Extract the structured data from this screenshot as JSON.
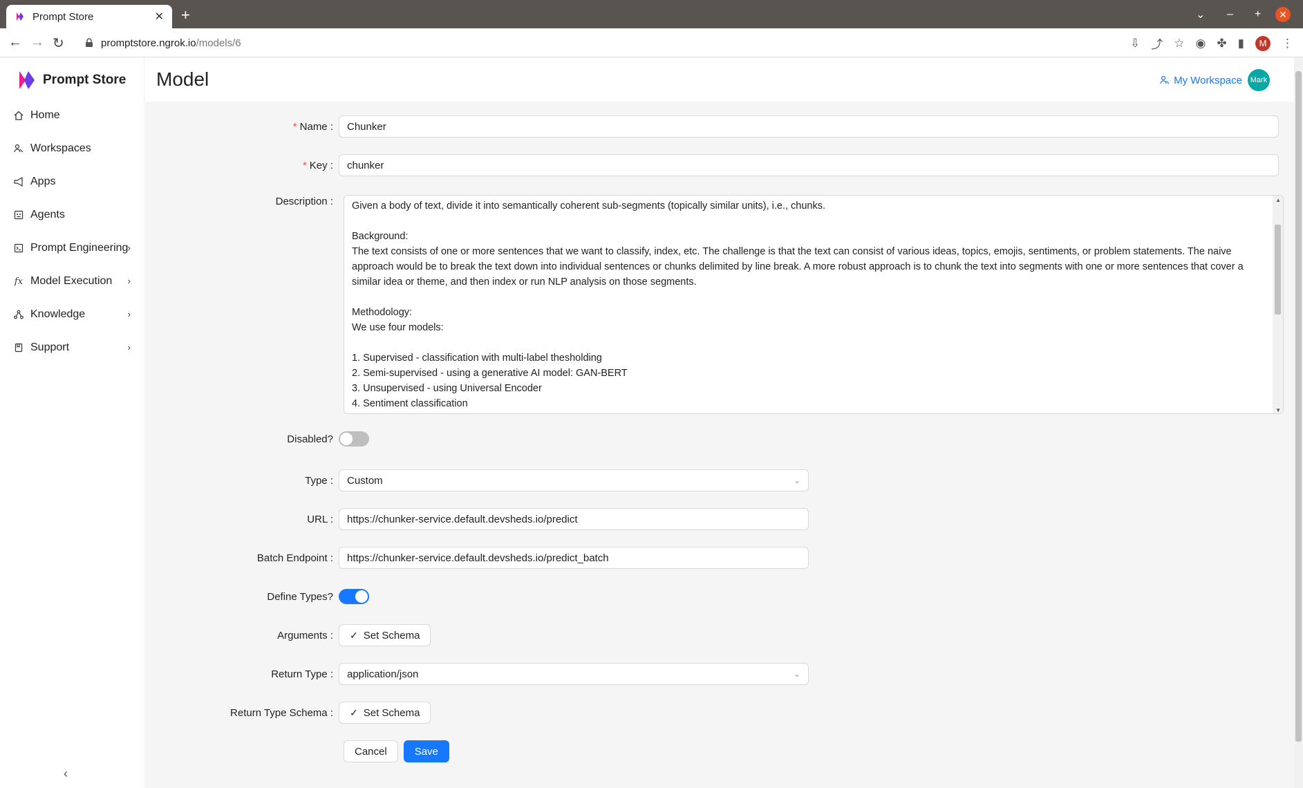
{
  "browser": {
    "tab_title": "Prompt Store",
    "url_host": "promptstore.ngrok.io",
    "url_path": "/models/6",
    "profile_initial": "M"
  },
  "sidebar": {
    "brand": "Prompt Store",
    "items": [
      {
        "label": "Home",
        "icon": "home-icon"
      },
      {
        "label": "Workspaces",
        "icon": "team-icon"
      },
      {
        "label": "Apps",
        "icon": "notification-icon"
      },
      {
        "label": "Agents",
        "icon": "robot-icon"
      },
      {
        "label": "Prompt Engineering",
        "icon": "code-icon"
      },
      {
        "label": "Model Execution",
        "icon": "function-icon"
      },
      {
        "label": "Knowledge",
        "icon": "share-icon"
      },
      {
        "label": "Support",
        "icon": "book-icon"
      }
    ]
  },
  "header": {
    "title": "Model",
    "workspace_label": "My Workspace",
    "avatar_text": "Mark"
  },
  "form": {
    "name_label": "Name",
    "name_value": "Chunker",
    "key_label": "Key",
    "key_value": "chunker",
    "description_label": "Description",
    "description_value": "Given a body of text, divide it into semantically coherent sub-segments (topically similar units), i.e., chunks.\n\nBackground:\nThe text consists of one or more sentences that we want to classify, index, etc. The challenge is that the text can consist of various ideas, topics, emojis, sentiments, or problem statements. The naive approach would be to break the text down into individual sentences or chunks delimited by line break. A more robust approach is to chunk the text into segments with one or more sentences that cover a similar idea or theme, and then index or run NLP analysis on those segments.\n\nMethodology:\nWe use four models:\n\n1. Supervised - classification with multi-label thesholding\n2. Semi-supervised - using a generative AI model: GAN-BERT\n3. Unsupervised - using Universal Encoder\n4. Sentiment classification",
    "disabled_label": "Disabled?",
    "disabled_value": false,
    "type_label": "Type",
    "type_value": "Custom",
    "url_label": "URL",
    "url_value": "https://chunker-service.default.devsheds.io/predict",
    "batch_label": "Batch Endpoint",
    "batch_value": "https://chunker-service.default.devsheds.io/predict_batch",
    "define_types_label": "Define Types?",
    "define_types_value": true,
    "arguments_label": "Arguments",
    "set_schema_label": "Set Schema",
    "return_type_label": "Return Type",
    "return_type_value": "application/json",
    "return_schema_label": "Return Type Schema",
    "cancel_label": "Cancel",
    "save_label": "Save"
  }
}
